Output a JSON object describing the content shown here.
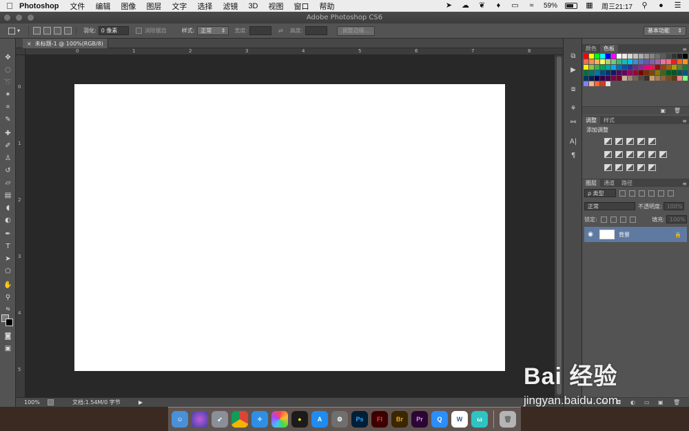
{
  "menubar": {
    "apple": "",
    "app": "Photoshop",
    "menus": [
      "文件",
      "编辑",
      "图像",
      "图层",
      "文字",
      "选择",
      "滤镜",
      "3D",
      "视图",
      "窗口",
      "帮助"
    ],
    "battery": "59%",
    "datetime": "周三21:17"
  },
  "window": {
    "title": "Adobe Photoshop CS6"
  },
  "options": {
    "feather_label": "羽化:",
    "feather_value": "0 像素",
    "antialias_label": "消除锯齿",
    "style_label": "样式:",
    "style_value": "正常",
    "width_label": "宽度:",
    "height_label": "高度:",
    "refine_edge": "调整边缘...",
    "workspace": "基本功能"
  },
  "document": {
    "tab_title": "未标题-1 @ 100%(RGB/8)",
    "ruler_h": [
      "0",
      "1",
      "2",
      "3",
      "4",
      "5",
      "6",
      "7",
      "8"
    ],
    "ruler_v": [
      "0",
      "1",
      "2",
      "3",
      "4",
      "5"
    ]
  },
  "status": {
    "zoom": "100%",
    "doc_info": "文档:1.54M/0 字节"
  },
  "panels": {
    "color_tab": "颜色",
    "swatches_tab": "色板",
    "adjustments_tab": "调整",
    "styles_tab": "样式",
    "add_adjustment": "添加调整",
    "layers_tab": "图层",
    "channels_tab": "通道",
    "paths_tab": "路径",
    "filter_kind": "ρ 类型",
    "blend_mode": "正常",
    "opacity_label": "不透明度:",
    "opacity_value": "100%",
    "lock_label": "锁定:",
    "fill_label": "填充:",
    "fill_value": "100%",
    "layer_name": "背景"
  },
  "dock": {
    "apps": [
      "Ps",
      "Fl",
      "Br",
      "Pr",
      "W"
    ]
  },
  "watermark": {
    "logo": "Bai 经验",
    "url": "jingyan.baidu.com"
  }
}
